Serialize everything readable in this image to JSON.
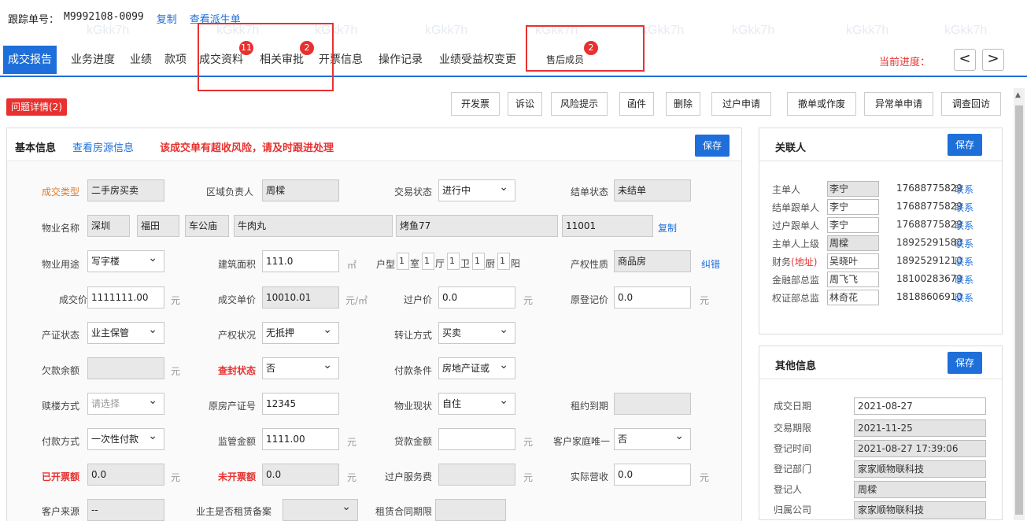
{
  "header": {
    "tracking_label": "跟踪单号：",
    "tracking_no": "M9992108-0099",
    "copy": "复制",
    "view_order": "查看派生单"
  },
  "watermark": "kGkk7h",
  "tabs": [
    {
      "label": "成交报告"
    },
    {
      "label": "业务进度"
    },
    {
      "label": "业绩"
    },
    {
      "label": "款项"
    },
    {
      "label": "成交资料",
      "badge": "11"
    },
    {
      "label": "相关审批",
      "badge": "2"
    },
    {
      "label": "开票信息"
    },
    {
      "label": "操作记录"
    },
    {
      "label": "业绩受益权变更"
    },
    {
      "label": "售后成员",
      "badge": "2"
    }
  ],
  "progress_label": "当前进度：",
  "nav": {
    "prev": "<",
    "next": ">"
  },
  "issue_tab": "问题详情(2)",
  "toolbar": [
    "开发票",
    "诉讼",
    "风险提示",
    "函件",
    "删除",
    "过户申请",
    "撤单或作废",
    "异常单申请",
    "调查回访"
  ],
  "main": {
    "title": "基本信息",
    "link": "查看房源信息",
    "warning": "该成交单有超收风险，请及时跟进处理",
    "save": "保存",
    "labels": {
      "deal_type": "成交类型",
      "region_owner": "区域负责人",
      "trade_status": "交易状态",
      "settle_status": "结单状态",
      "property_name": "物业名称",
      "copy": "复制",
      "usage": "物业用途",
      "area": "建筑面积",
      "area_unit": "㎡",
      "layout": "户型",
      "room": "室",
      "hall": "厅",
      "bath": "卫",
      "kitchen": "厨",
      "balcony": "阳",
      "ownership": "产权性质",
      "correct": "纠错",
      "price": "成交价",
      "yuan": "元",
      "unit_price": "成交单价",
      "unit_price_unit": "元/㎡",
      "transfer_price": "过户价",
      "orig_price": "原登记价",
      "cert_status": "产证状态",
      "property_status": "产权状况",
      "transfer_mode": "转让方式",
      "owed": "欠款余额",
      "seal_status": "查封状态",
      "pay_cond": "付款条件",
      "floor_mode": "赎楼方式",
      "orig_cert": "原房产证号",
      "property_state": "物业现状",
      "lease_expire": "租约到期",
      "pay_mode": "付款方式",
      "supervise": "监管金额",
      "loan": "贷款金额",
      "unique": "客户家庭唯一",
      "invoiced": "已开票额",
      "not_invoiced": "未开票额",
      "service_fee": "过户服务费",
      "actual_income": "实际营收",
      "source": "客户来源",
      "lease_record": "业主是否租赁备案",
      "lease_term": "租赁合同期限"
    },
    "values": {
      "deal_type": "二手房买卖",
      "region_owner": "周樑",
      "trade_status": "进行中",
      "settle_status": "未结单",
      "city": "深圳",
      "district": "福田",
      "area_name": "车公庙",
      "estate": "牛肉丸",
      "building": "烤鱼77",
      "room_no": "11001",
      "usage": "写字楼",
      "area": "111.0",
      "room": "1",
      "hall": "1",
      "bath": "1",
      "kitchen": "1",
      "balcony": "1",
      "ownership": "商品房",
      "price": "1111111.00",
      "unit_price": "10010.01",
      "transfer_price": "0.0",
      "orig_price": "0.0",
      "cert_status": "业主保管",
      "property_status": "无抵押",
      "transfer_mode": "买卖",
      "seal_status": "否",
      "pay_cond": "房地产证或",
      "floor_mode": "请选择",
      "orig_cert": "12345",
      "property_state": "自住",
      "pay_mode": "一次性付款",
      "supervise": "1111.00",
      "unique": "否",
      "invoiced": "0.0",
      "not_invoiced": "0.0",
      "actual_income": "0.0",
      "source": "--"
    }
  },
  "related": {
    "title": "关联人",
    "save": "保存",
    "contact": "联系",
    "rows": [
      {
        "role": "主单人",
        "name": "李宁",
        "phone": "17688775829",
        "ro": true
      },
      {
        "role": "结单跟单人",
        "name": "李宁",
        "phone": "17688775829"
      },
      {
        "role": "过户跟单人",
        "name": "李宁",
        "phone": "17688775829"
      },
      {
        "role": "主单人上级",
        "name": "周樑",
        "phone": "18925291588",
        "ro": true
      },
      {
        "role": "财务",
        "role_extra": "(地址)",
        "name": "吴晓叶",
        "phone": "18925291210"
      },
      {
        "role": "金融部总监",
        "name": "周飞飞",
        "phone": "18100283679"
      },
      {
        "role": "权证部总监",
        "name": "林奇花",
        "phone": "18188606910"
      }
    ]
  },
  "other": {
    "title": "其他信息",
    "save": "保存",
    "rows": [
      {
        "k": "成交日期",
        "v": "2021-08-27"
      },
      {
        "k": "交易期限",
        "v": "2021-11-25",
        "ro": true
      },
      {
        "k": "登记时间",
        "v": "2021-08-27 17:39:06",
        "ro": true
      },
      {
        "k": "登记部门",
        "v": "家家顺物联科技",
        "ro": true
      },
      {
        "k": "登记人",
        "v": "周樑",
        "ro": true
      },
      {
        "k": "归属公司",
        "v": "家家顺物联科技",
        "ro": true
      }
    ]
  },
  "colors": {
    "accent": "#1e6fd9",
    "danger": "#e8312f"
  }
}
